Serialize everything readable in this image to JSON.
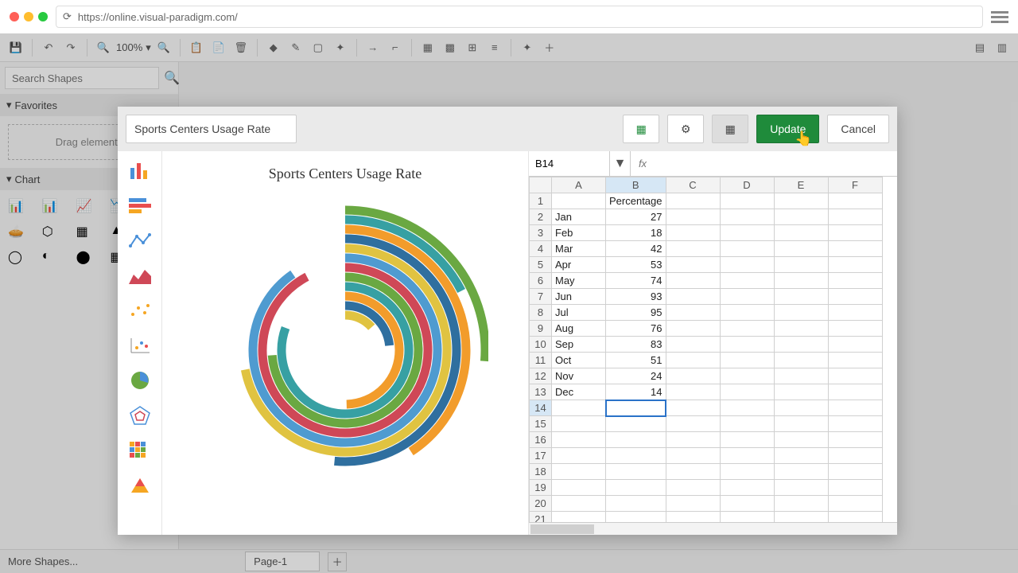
{
  "browser": {
    "url": "https://online.visual-paradigm.com/"
  },
  "toolbar": {
    "zoom": "100%"
  },
  "sidebar": {
    "search_placeholder": "Search Shapes",
    "favorites_label": "Favorites",
    "drag_hint": "Drag elements",
    "chart_label": "Chart",
    "more_shapes": "More Shapes..."
  },
  "footer": {
    "page_tab": "Page-1"
  },
  "dialog": {
    "title_value": "Sports Centers Usage Rate",
    "update_label": "Update",
    "cancel_label": "Cancel",
    "chart_title": "Sports Centers Usage Rate",
    "cell_ref": "B14",
    "fx_label": "fx"
  },
  "spreadsheet": {
    "columns": [
      "A",
      "B",
      "C",
      "D",
      "E",
      "F"
    ],
    "header_b": "Percentage",
    "rows": [
      {
        "n": 1
      },
      {
        "n": 2,
        "a": "Jan",
        "b": "27"
      },
      {
        "n": 3,
        "a": "Feb",
        "b": "18"
      },
      {
        "n": 4,
        "a": "Mar",
        "b": "42"
      },
      {
        "n": 5,
        "a": "Apr",
        "b": "53"
      },
      {
        "n": 6,
        "a": "May",
        "b": "74"
      },
      {
        "n": 7,
        "a": "Jun",
        "b": "93"
      },
      {
        "n": 8,
        "a": "Jul",
        "b": "95"
      },
      {
        "n": 9,
        "a": "Aug",
        "b": "76"
      },
      {
        "n": 10,
        "a": "Sep",
        "b": "83"
      },
      {
        "n": 11,
        "a": "Oct",
        "b": "51"
      },
      {
        "n": 12,
        "a": "Nov",
        "b": "24"
      },
      {
        "n": 13,
        "a": "Dec",
        "b": "14"
      },
      {
        "n": 14
      },
      {
        "n": 15
      },
      {
        "n": 16
      },
      {
        "n": 17
      },
      {
        "n": 18
      },
      {
        "n": 19
      },
      {
        "n": 20
      },
      {
        "n": 21
      }
    ]
  },
  "chart_data": {
    "type": "radial-bar",
    "title": "Sports Centers Usage Rate",
    "ylabel": "Percentage",
    "ylim": [
      0,
      100
    ],
    "categories": [
      "Jan",
      "Feb",
      "Mar",
      "Apr",
      "May",
      "Jun",
      "Jul",
      "Aug",
      "Sep",
      "Oct",
      "Nov",
      "Dec"
    ],
    "values": [
      27,
      18,
      42,
      53,
      74,
      93,
      95,
      76,
      83,
      51,
      24,
      14
    ],
    "colors": [
      "#6aa842",
      "#37a0a3",
      "#f29c2b",
      "#2f6f9f",
      "#e0c341",
      "#4f9bd0",
      "#cf4857",
      "#6aa842",
      "#37a0a3",
      "#f29c2b",
      "#2f6f9f",
      "#e0c341"
    ]
  }
}
